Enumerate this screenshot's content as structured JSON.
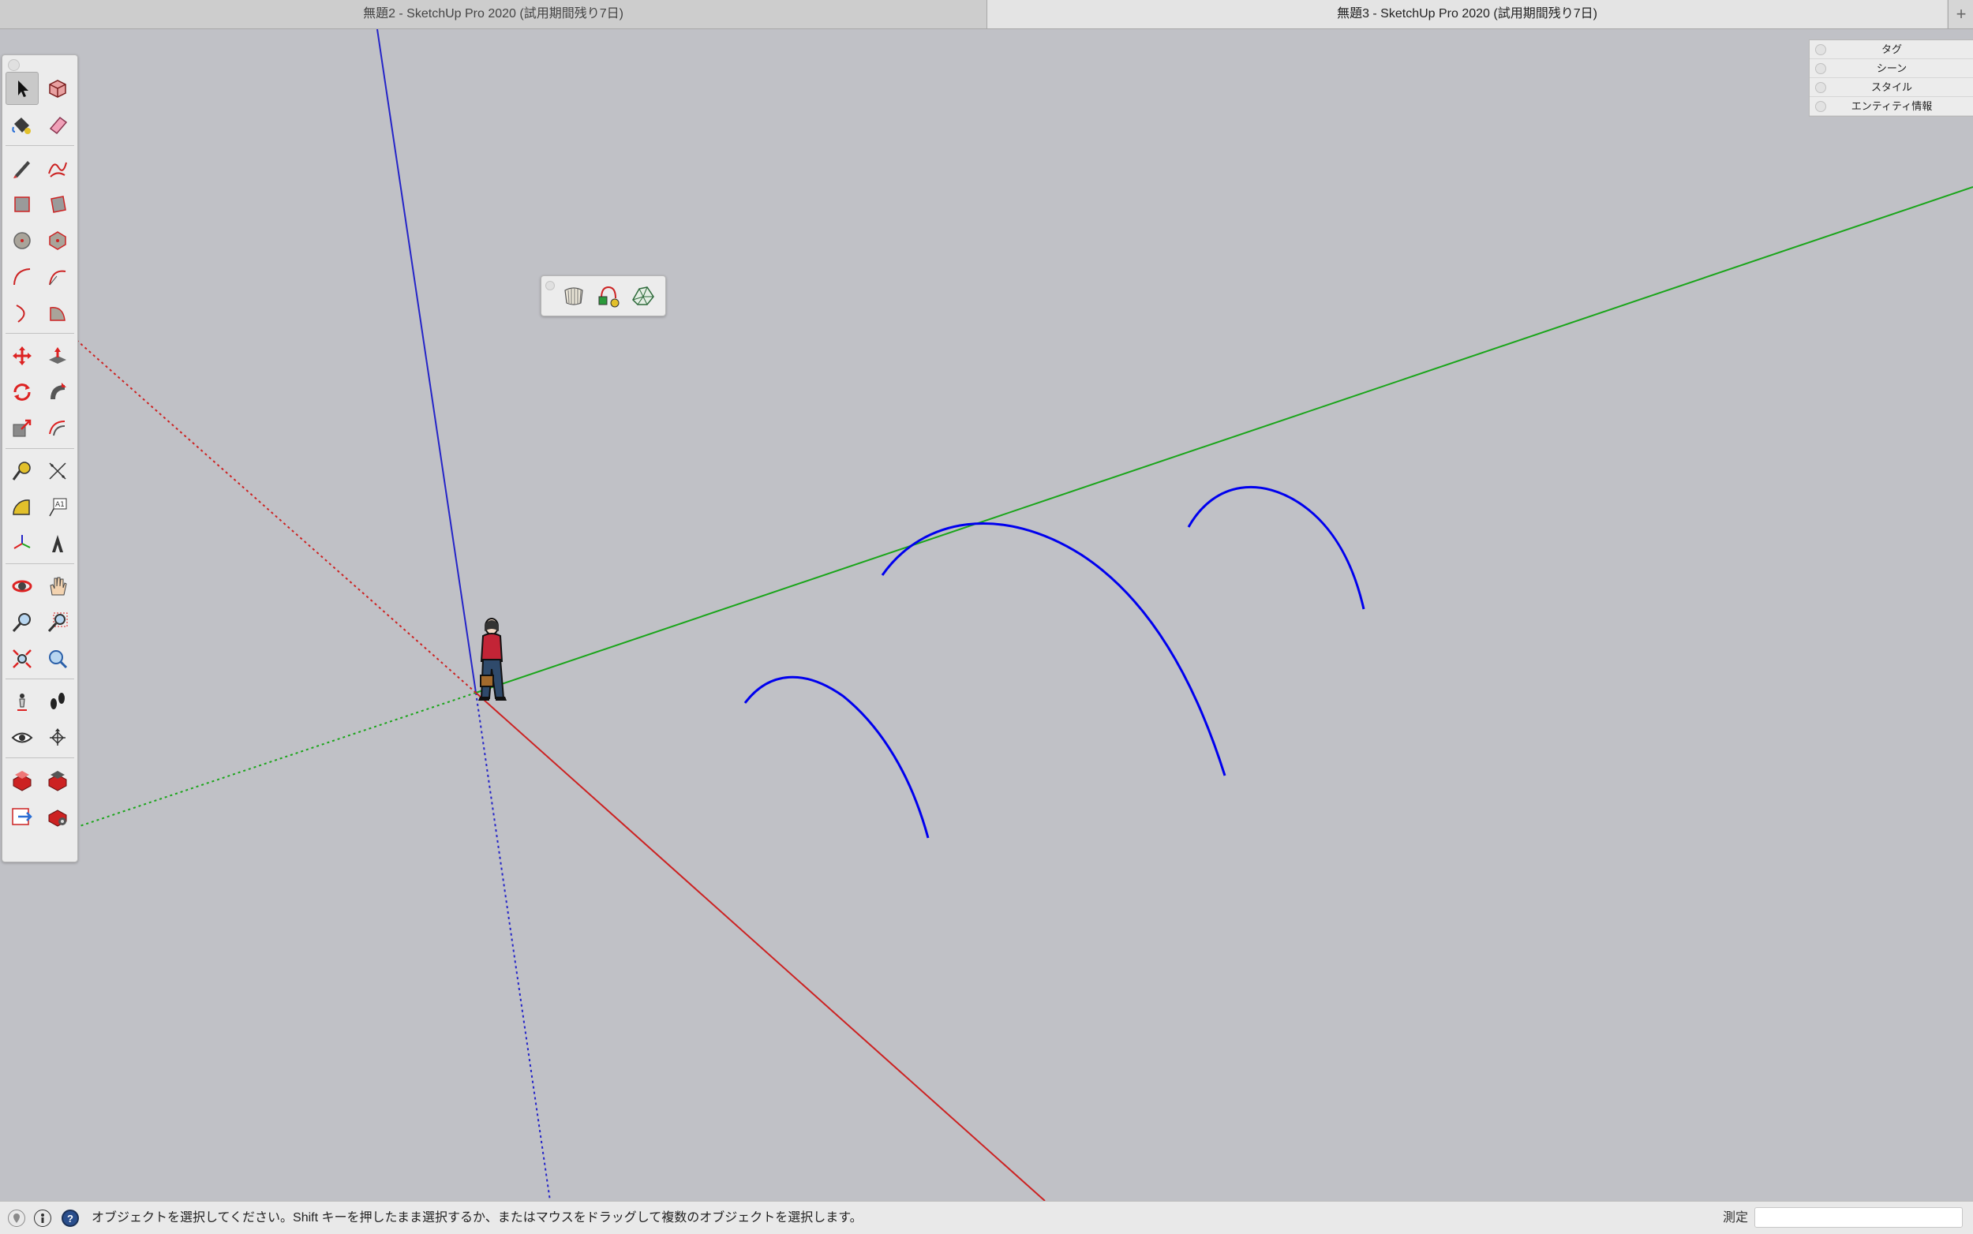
{
  "tabs": [
    {
      "title": "無題2 - SketchUp Pro 2020 (試用期間残り7日)",
      "active": false
    },
    {
      "title": "無題3 - SketchUp Pro 2020 (試用期間残り7日)",
      "active": true
    }
  ],
  "new_tab_label": "+",
  "toolbar": {
    "tools": [
      {
        "name": "select-tool",
        "icon": "arrow-cursor-icon",
        "active": true
      },
      {
        "name": "make-component-tool",
        "icon": "component-icon"
      },
      {
        "name": "paint-bucket-tool",
        "icon": "paint-bucket-icon"
      },
      {
        "name": "eraser-tool",
        "icon": "eraser-icon"
      },
      {
        "name": "line-tool",
        "icon": "pencil-icon"
      },
      {
        "name": "freehand-tool",
        "icon": "freehand-icon"
      },
      {
        "name": "rectangle-tool",
        "icon": "rectangle-icon"
      },
      {
        "name": "rotated-rectangle-tool",
        "icon": "rotated-rectangle-icon"
      },
      {
        "name": "circle-tool",
        "icon": "circle-icon"
      },
      {
        "name": "polygon-tool",
        "icon": "polygon-icon"
      },
      {
        "name": "arc-tool",
        "icon": "arc-icon"
      },
      {
        "name": "two-point-arc-tool",
        "icon": "two-point-arc-icon"
      },
      {
        "name": "three-point-arc-tool",
        "icon": "three-point-arc-icon"
      },
      {
        "name": "pie-tool",
        "icon": "pie-icon"
      },
      {
        "name": "move-tool",
        "icon": "move-arrows-icon"
      },
      {
        "name": "push-pull-tool",
        "icon": "push-pull-icon"
      },
      {
        "name": "rotate-tool",
        "icon": "rotate-icon"
      },
      {
        "name": "follow-me-tool",
        "icon": "follow-me-icon"
      },
      {
        "name": "scale-tool",
        "icon": "scale-icon"
      },
      {
        "name": "offset-tool",
        "icon": "offset-icon"
      },
      {
        "name": "tape-measure-tool",
        "icon": "tape-measure-icon"
      },
      {
        "name": "dimension-tool",
        "icon": "dimension-icon"
      },
      {
        "name": "protractor-tool",
        "icon": "protractor-icon"
      },
      {
        "name": "text-tool",
        "icon": "text-icon"
      },
      {
        "name": "axes-tool",
        "icon": "axes-icon"
      },
      {
        "name": "3d-text-tool",
        "icon": "3d-text-icon"
      },
      {
        "name": "orbit-tool",
        "icon": "orbit-icon"
      },
      {
        "name": "pan-tool",
        "icon": "pan-hand-icon"
      },
      {
        "name": "zoom-tool",
        "icon": "zoom-icon"
      },
      {
        "name": "zoom-window-tool",
        "icon": "zoom-window-icon"
      },
      {
        "name": "zoom-extents-tool",
        "icon": "zoom-extents-icon"
      },
      {
        "name": "previous-view-tool",
        "icon": "previous-view-icon"
      },
      {
        "name": "position-camera-tool",
        "icon": "position-camera-icon"
      },
      {
        "name": "walk-tool",
        "icon": "footprints-icon"
      },
      {
        "name": "look-around-tool",
        "icon": "eye-icon"
      },
      {
        "name": "section-plane-tool",
        "icon": "section-plane-icon"
      },
      {
        "name": "3d-warehouse-tool",
        "icon": "warehouse-icon"
      },
      {
        "name": "extension-warehouse-tool",
        "icon": "extension-warehouse-icon"
      },
      {
        "name": "send-to-layout-tool",
        "icon": "layout-icon"
      },
      {
        "name": "extension-manager-tool",
        "icon": "extension-manager-icon"
      }
    ]
  },
  "mini_toolbar": [
    {
      "name": "sandbox-from-contours",
      "icon": "sandbox-contours-icon"
    },
    {
      "name": "sandbox-drape",
      "icon": "sandbox-drape-icon"
    },
    {
      "name": "sandbox-smoove",
      "icon": "sandbox-smoove-icon"
    }
  ],
  "tray": {
    "items": [
      "タグ",
      "シーン",
      "スタイル",
      "エンティティ情報"
    ]
  },
  "status": {
    "message": "オブジェクトを選択してください。Shift キーを押したまま選択するか、またはマウスをドラッグして複数のオブジェクトを選択します。",
    "measure_label": "測定",
    "measure_value": ""
  },
  "colors": {
    "viewport_bg": "#c0c1c6",
    "blue_axis": "#2424c8",
    "green_axis": "#1aa51a",
    "red_axis": "#cc2222",
    "arc_color": "#0000ee"
  }
}
